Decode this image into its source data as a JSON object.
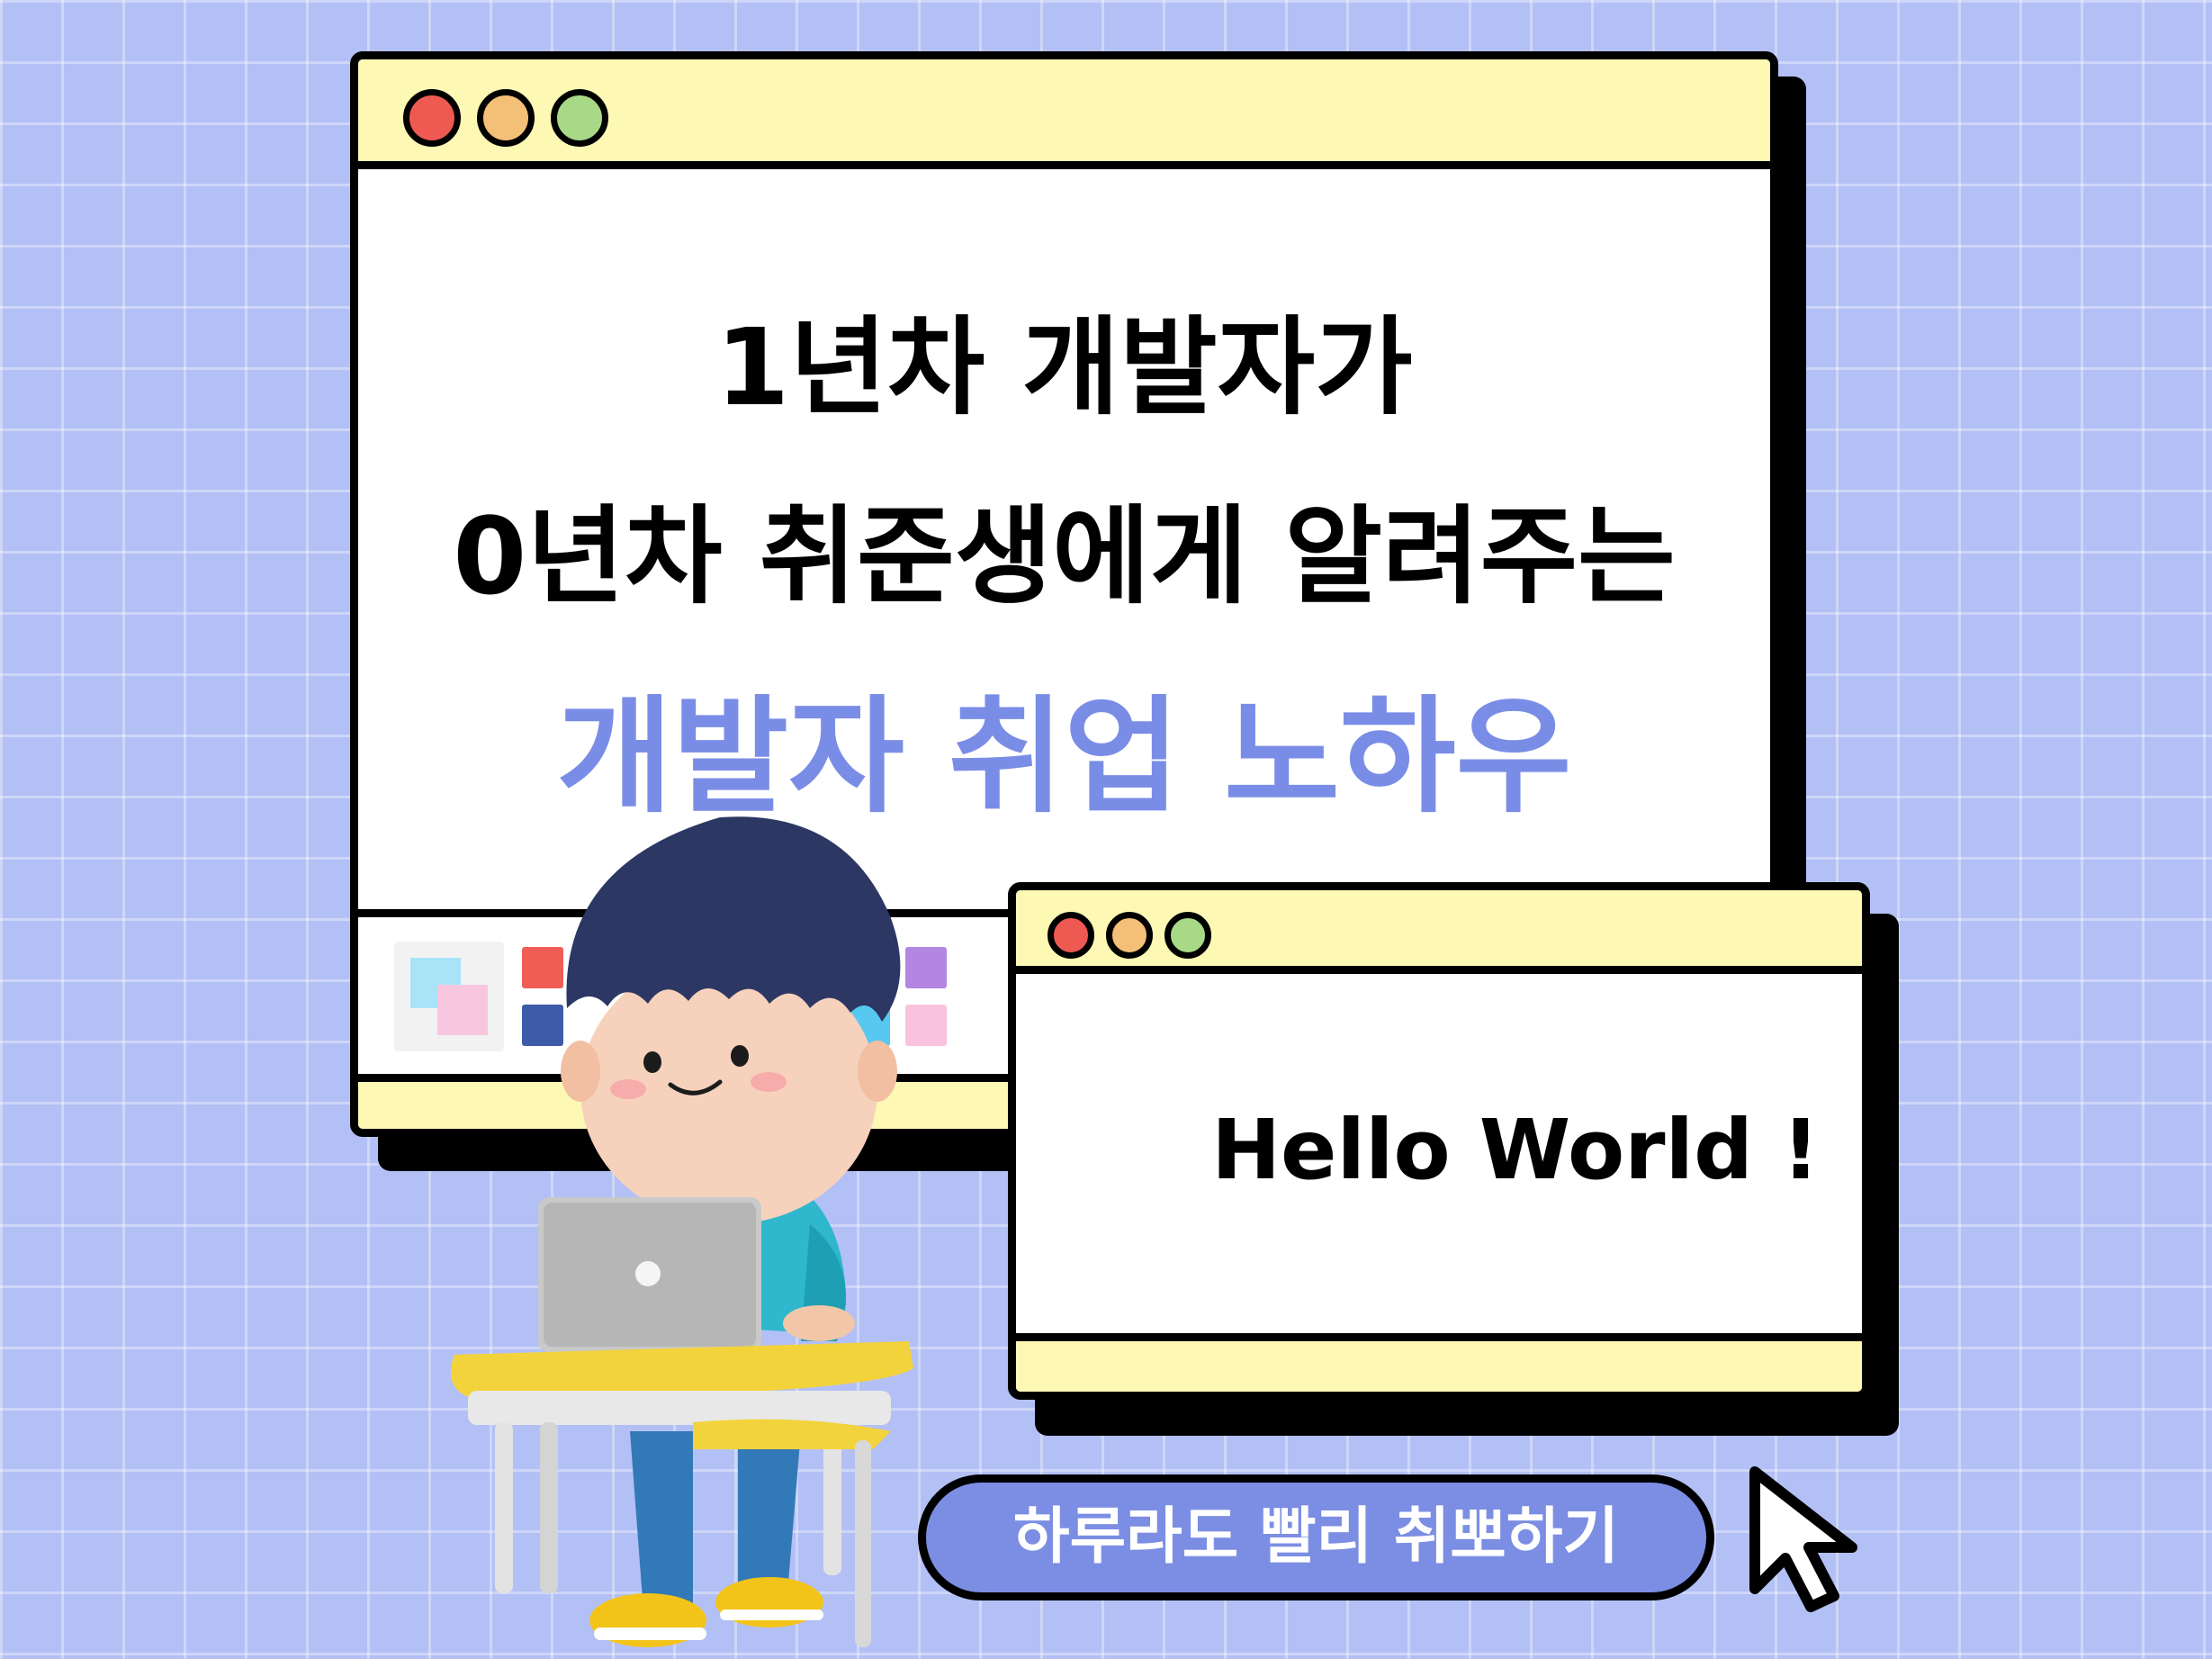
{
  "main_window": {
    "line1": "1년차 개발자가",
    "line2": "0년차 취준생에게 알려주는",
    "highlight": "개발자 취업 노하우",
    "highlight_color": "#7a8de6"
  },
  "hello_window": {
    "text": "Hello World !"
  },
  "cta_button": {
    "label": "하루라도 빨리 취뽀하기",
    "color": "#7b8ee3"
  },
  "window_controls": {
    "close_color": "#ee5a52",
    "minimize_color": "#f4bf77",
    "maximize_color": "#a8d987"
  },
  "illustration": {
    "name": "boy-with-laptop-illustration"
  },
  "cursor": {
    "icon": "arrow-cursor-icon"
  }
}
